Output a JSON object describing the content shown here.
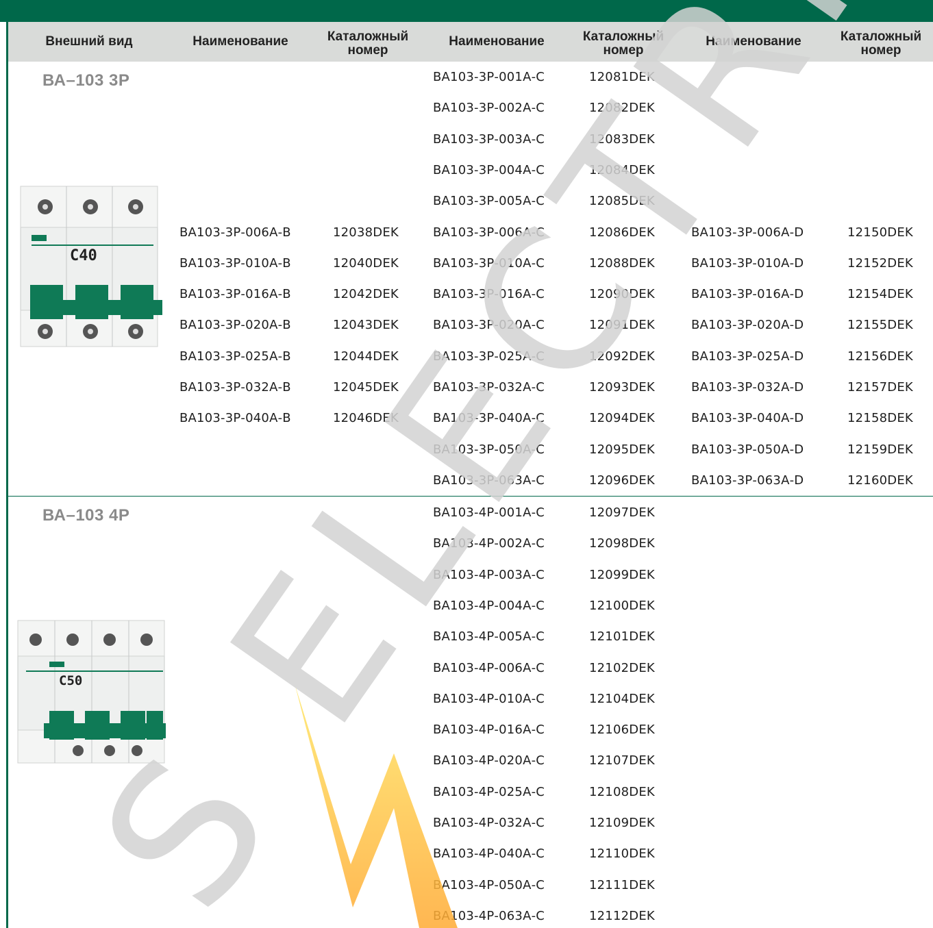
{
  "colors": {
    "brand_green": "#00684a",
    "header_bg": "#d9dbd9",
    "title_gray": "#8a8a8a",
    "breaker_handle": "#0f7a56"
  },
  "header": [
    "Внешний вид",
    "Наименование",
    "Каталожный номер",
    "Наименование",
    "Каталожный номер",
    "Наименование",
    "Каталожный номер"
  ],
  "sections": [
    {
      "title": "ВА–103 3P",
      "image_label": "C40",
      "rows": [
        [
          "",
          "",
          "ВА103-3Р-001А-С",
          "12081DEK",
          "",
          ""
        ],
        [
          "",
          "",
          "ВА103-3Р-002А-С",
          "12082DEK",
          "",
          ""
        ],
        [
          "",
          "",
          "ВА103-3Р-003А-С",
          "12083DEK",
          "",
          ""
        ],
        [
          "",
          "",
          "ВА103-3Р-004А-С",
          "12084DEK",
          "",
          ""
        ],
        [
          "",
          "",
          "ВА103-3Р-005А-С",
          "12085DEK",
          "",
          ""
        ],
        [
          "ВА103-3Р-006А-В",
          "12038DEK",
          "ВА103-3Р-006А-С",
          "12086DEK",
          "ВА103-3Р-006А-D",
          "12150DEK"
        ],
        [
          "ВА103-3Р-010А-В",
          "12040DEK",
          "ВА103-3Р-010А-С",
          "12088DEK",
          "ВА103-3Р-010А-D",
          "12152DEK"
        ],
        [
          "ВА103-3Р-016А-В",
          "12042DEK",
          "ВА103-3Р-016А-С",
          "12090DEK",
          "ВА103-3Р-016А-D",
          "12154DEK"
        ],
        [
          "ВА103-3Р-020А-В",
          "12043DEK",
          "ВА103-3Р-020А-С",
          "12091DEK",
          "ВА103-3Р-020А-D",
          "12155DEK"
        ],
        [
          "ВА103-3Р-025А-В",
          "12044DEK",
          "ВА103-3Р-025А-С",
          "12092DEK",
          "ВА103-3Р-025А-D",
          "12156DEK"
        ],
        [
          "ВА103-3Р-032А-В",
          "12045DEK",
          "ВА103-3Р-032А-С",
          "12093DEK",
          "ВА103-3Р-032А-D",
          "12157DEK"
        ],
        [
          "ВА103-3Р-040А-В",
          "12046DEK",
          "ВА103-3Р-040А-С",
          "12094DEK",
          "ВА103-3Р-040А-D",
          "12158DEK"
        ],
        [
          "",
          "",
          "ВА103-3Р-050А-С",
          "12095DEK",
          "ВА103-3Р-050А-D",
          "12159DEK"
        ],
        [
          "",
          "",
          "ВА103-3Р-063А-С",
          "12096DEK",
          "ВА103-3Р-063А-D",
          "12160DEK"
        ]
      ]
    },
    {
      "title": "ВА–103 4P",
      "image_label": "C50",
      "rows": [
        [
          "",
          "",
          "ВА103-4Р-001А-С",
          "12097DEK",
          "",
          ""
        ],
        [
          "",
          "",
          "ВА103-4Р-002А-С",
          "12098DEK",
          "",
          ""
        ],
        [
          "",
          "",
          "ВА103-4Р-003А-С",
          "12099DEK",
          "",
          ""
        ],
        [
          "",
          "",
          "ВА103-4Р-004А-С",
          "12100DEK",
          "",
          ""
        ],
        [
          "",
          "",
          "ВА103-4Р-005А-С",
          "12101DEK",
          "",
          ""
        ],
        [
          "",
          "",
          "ВА103-4Р-006А-С",
          "12102DEK",
          "",
          ""
        ],
        [
          "",
          "",
          "ВА103-4Р-010А-С",
          "12104DEK",
          "",
          ""
        ],
        [
          "",
          "",
          "ВА103-4Р-016А-С",
          "12106DEK",
          "",
          ""
        ],
        [
          "",
          "",
          "ВА103-4Р-020А-С",
          "12107DEK",
          "",
          ""
        ],
        [
          "",
          "",
          "ВА103-4Р-025А-С",
          "12108DEK",
          "",
          ""
        ],
        [
          "",
          "",
          "ВА103-4Р-032А-С",
          "12109DEK",
          "",
          ""
        ],
        [
          "",
          "",
          "ВА103-4Р-040А-С",
          "12110DEK",
          "",
          ""
        ],
        [
          "",
          "",
          "ВА103-4Р-050А-С",
          "12111DEK",
          "",
          ""
        ],
        [
          "",
          "",
          "ВА103-4Р-063А-С",
          "12112DEK",
          "",
          ""
        ]
      ]
    }
  ],
  "watermark": {
    "text": "S ELECTRIC"
  }
}
